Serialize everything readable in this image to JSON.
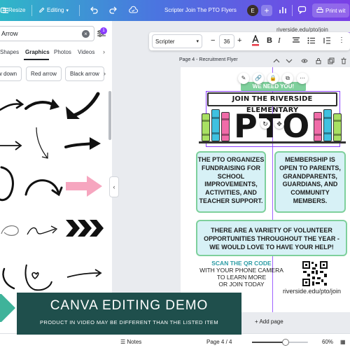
{
  "colors": {
    "brand_purple": "#8b3dff",
    "banner_green": "#7ed09c",
    "infobox_fill": "#d7f1f6",
    "overlay_teal": "#1f4f4c",
    "scan_teal": "#2c9ca5",
    "pink_arrow": "#f6a6bf"
  },
  "topbar": {
    "menu_icon": "hamburger-icon",
    "resize_label": "Resize",
    "editing_label": "Editing",
    "undo_icon": "undo-icon",
    "redo_icon": "redo-icon",
    "cloud_icon": "cloud-check-icon",
    "title": "Scripter Join The PTO Flyers",
    "avatar_initial": "E",
    "add_icon": "plus-icon",
    "chart_icon": "bar-chart-icon",
    "comment_icon": "comment-icon",
    "print_label": "Print wit"
  },
  "left_panel": {
    "search_value": "Arrow",
    "filter_badge": "1",
    "tabs": [
      "Shapes",
      "Graphics",
      "Photos",
      "Videos"
    ],
    "active_tab": "Graphics",
    "pills": [
      "w down",
      "Red arrow",
      "Black arrow"
    ]
  },
  "text_toolbar": {
    "font_name": "Scripter",
    "font_size": "36",
    "minus": "−",
    "plus": "+",
    "text_color_icon": "text-color-icon",
    "bold_label": "B",
    "italic_label": "I"
  },
  "page_header": {
    "label": "Page 4 - Recruitment Flyer",
    "icons": [
      "chevron-up-icon",
      "chevron-down-icon",
      "lock-icon",
      "eye-icon",
      "copy-icon",
      "trash-icon",
      "add-page-icon"
    ]
  },
  "flyer": {
    "top_url": "riverside.edu/pto/join",
    "we_need_you": "WE NEED YOU!",
    "banner": "JOIN THE RIVERSIDE ELEMENTARY",
    "pto": "PTO",
    "box_left": "THE PTO ORGANIZES FUNDRAISING FOR SCHOOL IMPROVEMENTS, ACTIVITIES, AND TEACHER SUPPORT.",
    "box_right": "MEMBERSHIP IS OPEN TO PARENTS, GRANDPARENTS, GUARDIANS, AND COMMUNITY MEMBERS.",
    "box_wide": "THERE ARE A VARIETY OF VOLUNTEER OPPORTUNITIES THROUGHOUT THE YEAR - WE WOULD LOVE TO HAVE YOUR HELP!",
    "scan_title": "SCAN THE QR CODE",
    "scan_line1": "WITH YOUR PHONE CAMERA",
    "scan_line2": "TO LEARN MORE",
    "scan_line3": "OR JOIN TODAY",
    "bottom_url": "riverside.edu/pto/join"
  },
  "add_page_label": "+ Add page",
  "status_bar": {
    "notes_label": "Notes",
    "page_indicator": "Page 4 / 4",
    "zoom_label": "60%",
    "zoom_value": 0.6
  },
  "overlay": {
    "title": "CANVA EDITING DEMO",
    "subtitle": "PRODUCT IN VIDEO MAY BE DIFFERENT THAN THE LISTED ITEM"
  }
}
